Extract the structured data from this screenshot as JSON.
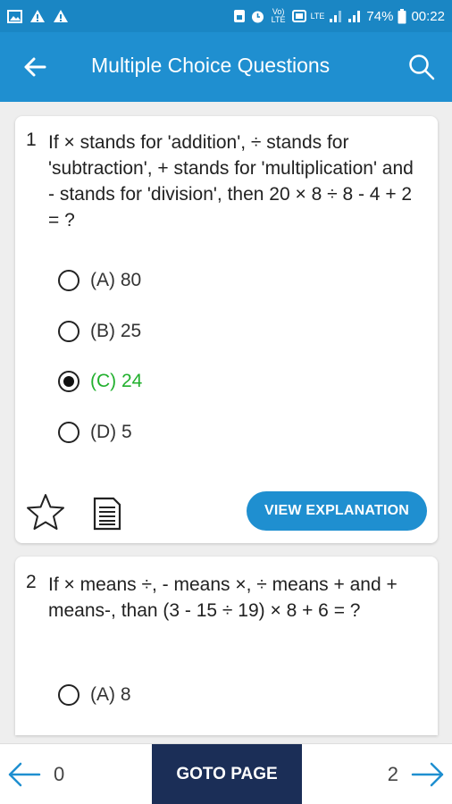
{
  "status_bar": {
    "battery": "74%",
    "time": "00:22",
    "network_volte": "Vo) LTE",
    "network_lte": "LTE"
  },
  "app_bar": {
    "title": "Multiple Choice Questions"
  },
  "questions": [
    {
      "number": "1",
      "text": "If × stands for 'addition', ÷ stands for 'subtraction', + stands for 'multiplication' and - stands for 'division', then 20 × 8 ÷ 8 - 4 + 2 = ?",
      "options": [
        {
          "label": "(A) 80",
          "selected": false
        },
        {
          "label": "(B) 25",
          "selected": false
        },
        {
          "label": "(C) 24",
          "selected": true
        },
        {
          "label": "(D) 5",
          "selected": false
        }
      ],
      "explanation_label": "VIEW EXPLANATION"
    },
    {
      "number": "2",
      "text": "If × means ÷, - means ×, ÷ means + and + means-, than (3 - 15 ÷ 19) × 8 + 6 = ?",
      "options": [
        {
          "label": "(A) 8",
          "selected": false
        }
      ]
    }
  ],
  "bottom_bar": {
    "prev_page": "0",
    "goto_label": "GOTO PAGE",
    "next_page": "2"
  },
  "colors": {
    "status_bar": "#1a86c4",
    "app_bar": "#1f8fd0",
    "selected_option": "#22b02e",
    "goto_button": "#1b2e57",
    "arrow": "#1f8fd0"
  }
}
